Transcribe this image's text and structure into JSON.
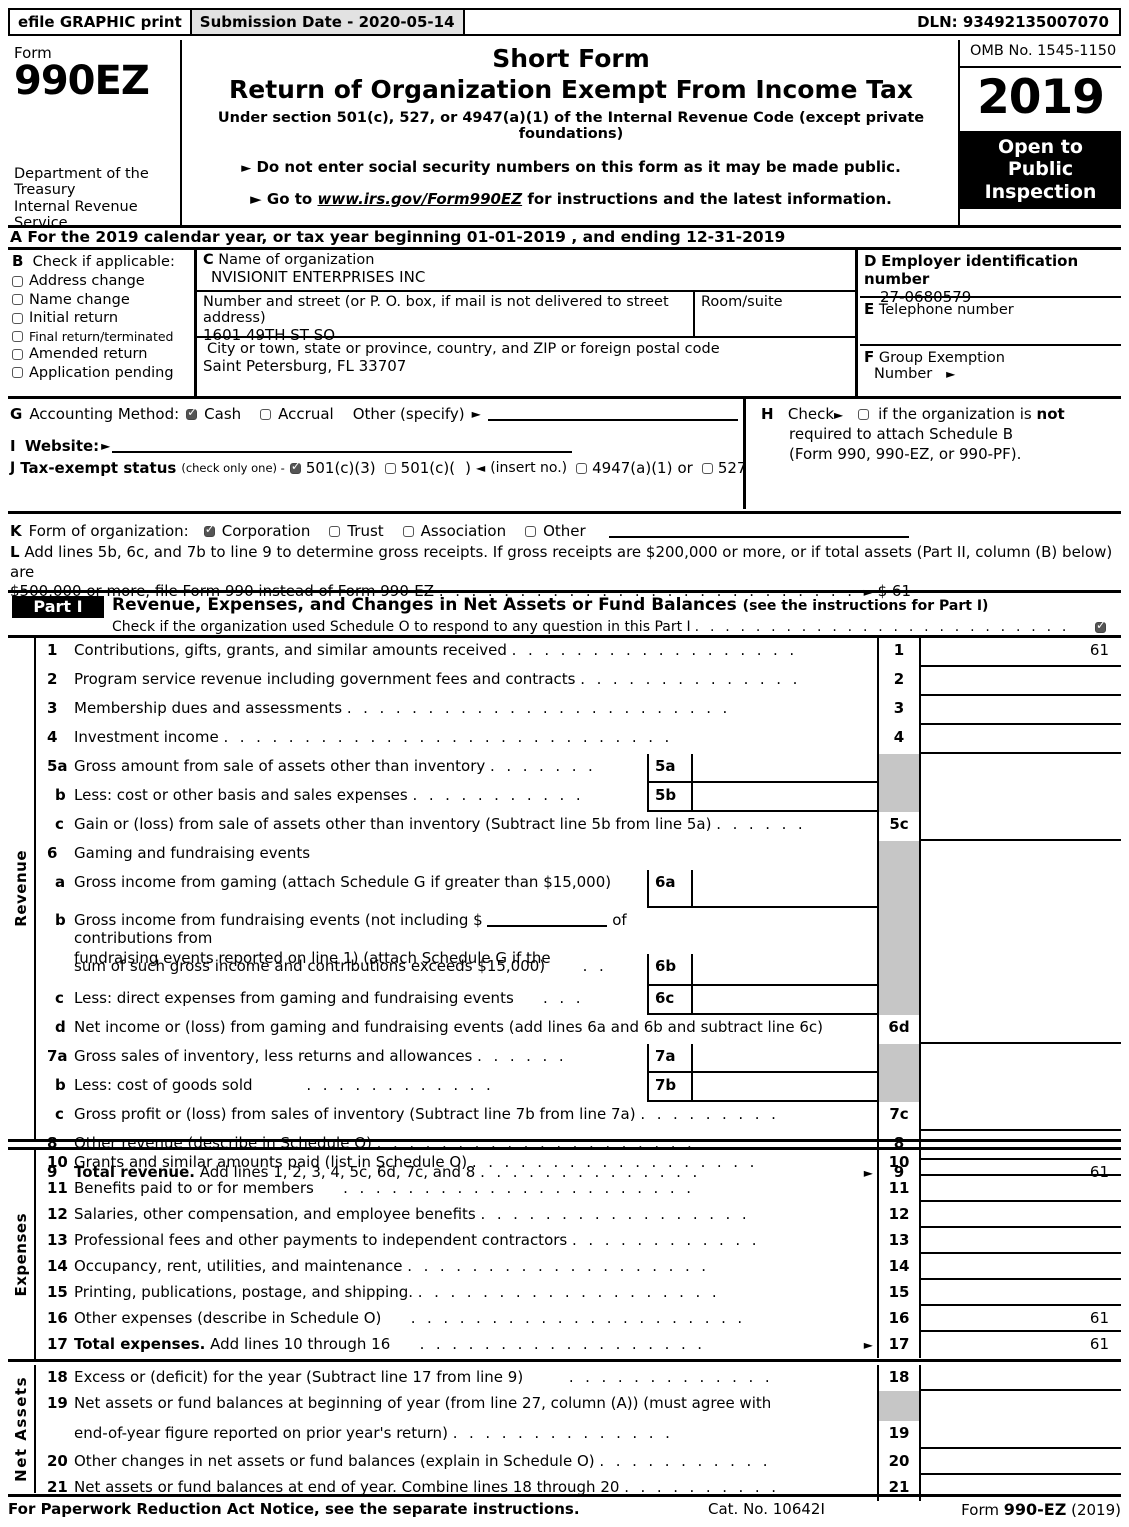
{
  "efile": {
    "print_label": "efile GRAPHIC print",
    "submission_label": "Submission Date - 2020-05-14",
    "dln": "DLN: 93492135007070"
  },
  "header": {
    "form_word": "Form",
    "form_number": "990EZ",
    "department": "Department of the Treasury Internal Revenue Service",
    "title_line1": "Short Form",
    "title_line2": "Return of Organization Exempt From Income Tax",
    "subtitle": "Under section 501(c), 527, or 4947(a)(1) of the Internal Revenue Code (except private foundations)",
    "bullet1": "Do not enter social security numbers on this form as it may be made public.",
    "bullet2_pre": "Go to",
    "bullet2_url": "www.irs.gov/Form990EZ",
    "bullet2_post": "for instructions and the latest information.",
    "omb": "OMB No. 1545-1150",
    "year": "2019",
    "open_to_public": "Open to Public Inspection"
  },
  "line_a": {
    "letter": "A",
    "text_pre": "For the 2019 calendar year, or tax year beginning",
    "begin_date": "01-01-2019",
    "text_mid": ", and ending",
    "end_date": "12-31-2019"
  },
  "section_b": {
    "letter": "B",
    "heading": "Check if applicable:",
    "items": [
      {
        "label": "Address change",
        "checked": false
      },
      {
        "label": "Name change",
        "checked": false
      },
      {
        "label": "Initial return",
        "checked": false
      },
      {
        "label": "Final return/terminated",
        "checked": false
      },
      {
        "label": "Amended return",
        "checked": false
      },
      {
        "label": "Application pending",
        "checked": false
      }
    ]
  },
  "section_c": {
    "letter": "C",
    "name_caption": "Name of organization",
    "name_value": "NVISIONIT ENTERPRISES INC",
    "street_caption": "Number and street (or P. O. box, if mail is not delivered to street address)",
    "street_value": "1601 49TH ST SO",
    "room_caption": "Room/suite",
    "room_value": "",
    "city_caption": "City or town, state or province, country, and ZIP or foreign postal code",
    "city_value": "Saint Petersburg, FL   33707"
  },
  "section_d": {
    "letter": "D",
    "caption": "Employer identification number",
    "value": "27-0680579"
  },
  "section_e": {
    "letter": "E",
    "caption": "Telephone number",
    "value": ""
  },
  "section_f": {
    "letter": "F",
    "caption_line1": "Group Exemption",
    "caption_line2": "Number"
  },
  "section_g": {
    "letter": "G",
    "label": "Accounting Method:",
    "cash": {
      "label": "Cash",
      "checked": true
    },
    "accrual": {
      "label": "Accrual",
      "checked": false
    },
    "other_label": "Other (specify)",
    "other_value": ""
  },
  "section_h": {
    "letter": "H",
    "check_label": "Check",
    "checked": false,
    "line1_a": "if the organization is",
    "line1_b": "not",
    "line2": "required to attach Schedule B",
    "line3": "(Form 990, 990-EZ, or 990-PF)."
  },
  "section_i": {
    "letter": "I",
    "label": "Website:",
    "value": ""
  },
  "section_j": {
    "letter": "J",
    "label": "Tax-exempt status",
    "note": "(check only one) -",
    "opt1": {
      "label": "501(c)(3)",
      "checked": true
    },
    "opt2": {
      "label": "501(c)(",
      "suffix": ")",
      "checked": false
    },
    "insert_note": "(insert no.)",
    "opt3": {
      "label": "4947(a)(1)",
      "checked": false
    },
    "or_word": "or",
    "opt4": {
      "label": "527",
      "checked": false
    }
  },
  "section_k": {
    "letter": "K",
    "label": "Form of organization:",
    "options": [
      {
        "label": "Corporation",
        "checked": true
      },
      {
        "label": "Trust",
        "checked": false
      },
      {
        "label": "Association",
        "checked": false
      },
      {
        "label": "Other",
        "checked": false
      }
    ]
  },
  "section_l": {
    "letter": "L",
    "line1": "Add lines 5b, 6c, and 7b to line 9 to determine gross receipts. If gross receipts are $200,000 or more, or if total assets (Part II, column (B) below) are",
    "line2": "$500,000 or more, file Form 990 instead of Form 990-EZ",
    "amount": "$ 61"
  },
  "part_i": {
    "tag": "Part I",
    "title": "Revenue, Expenses, and Changes in Net Assets or Fund Balances",
    "note": "(see the instructions for Part I)",
    "schedule_o_text": "Check if the organization used Schedule O to respond to any question in this Part I",
    "schedule_o_checked": true
  },
  "revenue": {
    "section_label": "Revenue",
    "rows": [
      {
        "num": "1",
        "text": "Contributions, gifts, grants, and similar amounts received",
        "leaders": true,
        "lnum": "1",
        "amount": "61",
        "grey": false
      },
      {
        "num": "2",
        "text": "Program service revenue including government fees and contracts",
        "leaders": true,
        "lnum": "2",
        "amount": "",
        "grey": false
      },
      {
        "num": "3",
        "text": "Membership dues and assessments",
        "leaders": true,
        "lnum": "3",
        "amount": "",
        "grey": false
      },
      {
        "num": "4",
        "text": "Investment income",
        "leaders": true,
        "lnum": "4",
        "amount": "",
        "grey": false
      },
      {
        "num": "5a",
        "text": "Gross amount from sale of assets other than inventory",
        "sub_num": "5a",
        "sub_val": "",
        "grey": true
      },
      {
        "num": "b",
        "text": "Less: cost or other basis and sales expenses",
        "sub_num": "5b",
        "sub_val": "",
        "grey": true
      },
      {
        "num": "c",
        "text": "Gain or (loss) from sale of assets other than inventory (Subtract line 5b from line 5a)",
        "lnum": "5c",
        "amount": "",
        "grey": false
      },
      {
        "num": "6",
        "text": "Gaming and fundraising events",
        "grey": true
      },
      {
        "num": "a",
        "text": "Gross income from gaming (attach Schedule G if greater than $15,000)",
        "sub_num": "6a",
        "sub_val": "",
        "grey": true
      },
      {
        "num": "b",
        "text": "Gross income from fundraising events (not including $",
        "text2": "of contributions from",
        "text3": "fundraising events reported on line 1) (attach Schedule G if the",
        "grey": true
      },
      {
        "num": "",
        "text": "sum of such gross income and contributions exceeds $15,000)",
        "sub_num": "6b",
        "sub_val": "",
        "grey": true
      },
      {
        "num": "c",
        "text": "Less: direct expenses from gaming and fundraising events",
        "sub_num": "6c",
        "sub_val": "",
        "grey": true
      },
      {
        "num": "d",
        "text": "Net income or (loss) from gaming and fundraising events (add lines 6a and 6b and subtract line 6c)",
        "lnum": "6d",
        "amount": "",
        "grey": false
      },
      {
        "num": "7a",
        "text": "Gross sales of inventory, less returns and allowances",
        "sub_num": "7a",
        "sub_val": "",
        "grey": true
      },
      {
        "num": "b",
        "text": "Less: cost of goods sold",
        "sub_num": "7b",
        "sub_val": "",
        "grey": true
      },
      {
        "num": "c",
        "text": "Gross profit or (loss) from sales of inventory (Subtract line 7b from line 7a)",
        "lnum": "7c",
        "amount": "",
        "grey": false
      },
      {
        "num": "8",
        "text": "Other revenue (describe in Schedule O)",
        "lnum": "8",
        "amount": "",
        "grey": false
      },
      {
        "num": "9",
        "text_bold": "Total revenue.",
        "text": "Add lines 1, 2, 3, 4, 5c, 6d, 7c, and 8",
        "lnum": "9",
        "amount": "61",
        "grey": false,
        "arrow": true
      }
    ]
  },
  "expenses": {
    "section_label": "Expenses",
    "rows": [
      {
        "num": "10",
        "text": "Grants and similar amounts paid (list in Schedule O)",
        "lnum": "10",
        "amount": ""
      },
      {
        "num": "11",
        "text": "Benefits paid to or for members",
        "lnum": "11",
        "amount": ""
      },
      {
        "num": "12",
        "text": "Salaries, other compensation, and employee benefits",
        "lnum": "12",
        "amount": ""
      },
      {
        "num": "13",
        "text": "Professional fees and other payments to independent contractors",
        "lnum": "13",
        "amount": ""
      },
      {
        "num": "14",
        "text": "Occupancy, rent, utilities, and maintenance",
        "lnum": "14",
        "amount": ""
      },
      {
        "num": "15",
        "text": "Printing, publications, postage, and shipping.",
        "lnum": "15",
        "amount": ""
      },
      {
        "num": "16",
        "text": "Other expenses (describe in Schedule O)",
        "lnum": "16",
        "amount": "61"
      },
      {
        "num": "17",
        "text_bold": "Total expenses.",
        "text": "Add lines 10 through 16",
        "lnum": "17",
        "amount": "61",
        "arrow": true
      }
    ]
  },
  "net_assets": {
    "section_label": "Net Assets",
    "rows": [
      {
        "num": "18",
        "text": "Excess or (deficit) for the year (Subtract line 17 from line 9)",
        "lnum": "18",
        "amount": ""
      },
      {
        "num": "19",
        "text": "Net assets or fund balances at beginning of year (from line 27, column (A)) (must agree with",
        "grey": true
      },
      {
        "num": "",
        "text": "end-of-year figure reported on prior year's return)",
        "lnum": "19",
        "amount": ""
      },
      {
        "num": "20",
        "text": "Other changes in net assets or fund balances (explain in Schedule O)",
        "lnum": "20",
        "amount": ""
      },
      {
        "num": "21",
        "text": "Net assets or fund balances at end of year. Combine lines 18 through 20",
        "lnum": "21",
        "amount": ""
      }
    ]
  },
  "footer": {
    "notice": "For Paperwork Reduction Act Notice, see the separate instructions.",
    "cat_no": "Cat. No. 10642I",
    "form_pre": "Form",
    "form_name": "990-EZ",
    "form_year": "(2019)"
  }
}
